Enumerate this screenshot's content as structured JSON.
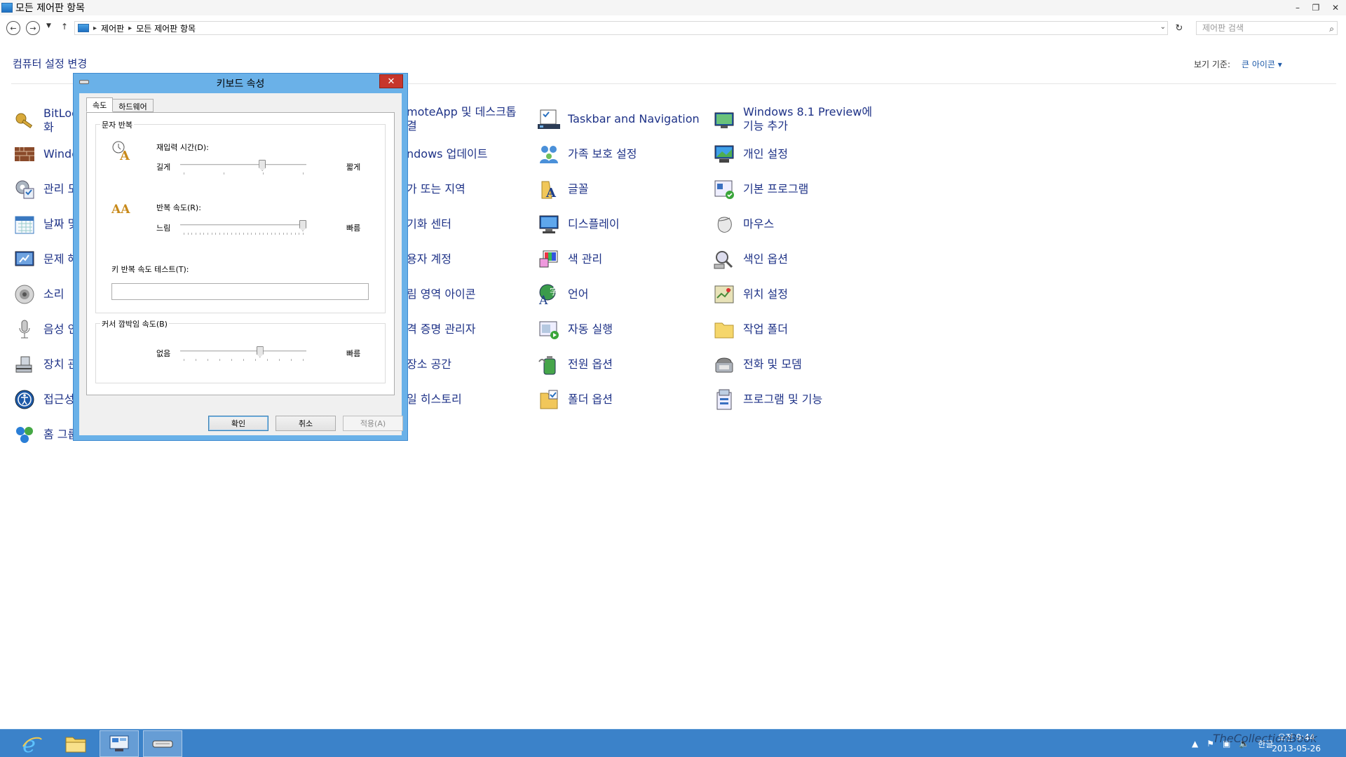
{
  "window": {
    "title": "모든 제어판 항목",
    "controls": [
      "–",
      "❐",
      "✕"
    ]
  },
  "address": {
    "breadcrumb": [
      "제어판",
      "모든 제어판 항목"
    ],
    "search_placeholder": "제어판 검색"
  },
  "header": {
    "title": "컴퓨터 설정 변경",
    "view_by_label": "보기 기준:",
    "view_by_value": "큰 아이콘 ▾"
  },
  "items": [
    {
      "label": "BitLoc",
      "label2": "화",
      "icon": "bitlocker-key-icon"
    },
    {
      "label": "Windc",
      "label2": "",
      "icon": "windows-firewall-icon"
    },
    {
      "label": "관리 도",
      "label2": "",
      "icon": "admin-tools-icon"
    },
    {
      "label": "날짜 및",
      "label2": "",
      "icon": "calendar-icon"
    },
    {
      "label": "문제 해",
      "label2": "",
      "icon": "troubleshoot-icon"
    },
    {
      "label": "소리",
      "label2": "",
      "icon": "speaker-icon"
    },
    {
      "label": "음성 인",
      "label2": "",
      "icon": "microphone-icon"
    },
    {
      "label": "장치 관",
      "label2": "",
      "icon": "device-manager-icon"
    },
    {
      "label": "접근성",
      "label2": "",
      "icon": "ease-of-access-icon"
    },
    {
      "label": "홈 그룹",
      "label2": "",
      "icon": "homegroup-icon"
    },
    {
      "label": "moteApp 및 데스크톱",
      "label2": "결",
      "icon": ""
    },
    {
      "label": "ndows 업데이트",
      "label2": "",
      "icon": ""
    },
    {
      "label": "가 또는 지역",
      "label2": "",
      "icon": ""
    },
    {
      "label": "기화 센터",
      "label2": "",
      "icon": ""
    },
    {
      "label": "용자 계정",
      "label2": "",
      "icon": ""
    },
    {
      "label": "림 영역 아이콘",
      "label2": "",
      "icon": ""
    },
    {
      "label": "격 증명 관리자",
      "label2": "",
      "icon": ""
    },
    {
      "label": "장소 공간",
      "label2": "",
      "icon": ""
    },
    {
      "label": "일 히스토리",
      "label2": "",
      "icon": ""
    },
    {
      "label": "Taskbar and Navigation",
      "label2": "",
      "icon": "taskbar-icon"
    },
    {
      "label": "가족 보호 설정",
      "label2": "",
      "icon": "family-safety-icon"
    },
    {
      "label": "글꼴",
      "label2": "",
      "icon": "fonts-folder-icon"
    },
    {
      "label": "디스플레이",
      "label2": "",
      "icon": "display-monitor-icon"
    },
    {
      "label": "색 관리",
      "label2": "",
      "icon": "color-management-icon"
    },
    {
      "label": "언어",
      "label2": "",
      "icon": "language-icon"
    },
    {
      "label": "자동 실행",
      "label2": "",
      "icon": "autoplay-icon"
    },
    {
      "label": "전원 옵션",
      "label2": "",
      "icon": "power-options-icon"
    },
    {
      "label": "폴더 옵션",
      "label2": "",
      "icon": "folder-options-icon"
    },
    {
      "label": "Windows 8.1 Preview에",
      "label2": "기능 추가",
      "icon": "add-features-icon"
    },
    {
      "label": "개인 설정",
      "label2": "",
      "icon": "personalization-icon"
    },
    {
      "label": "기본 프로그램",
      "label2": "",
      "icon": "default-programs-icon"
    },
    {
      "label": "마우스",
      "label2": "",
      "icon": "mouse-icon"
    },
    {
      "label": "색인 옵션",
      "label2": "",
      "icon": "indexing-icon"
    },
    {
      "label": "위치 설정",
      "label2": "",
      "icon": "location-icon"
    },
    {
      "label": "작업 폴더",
      "label2": "",
      "icon": "work-folder-icon"
    },
    {
      "label": "전화 및 모뎀",
      "label2": "",
      "icon": "phone-modem-icon"
    },
    {
      "label": "프로그램 및 기능",
      "label2": "",
      "icon": "programs-features-icon"
    }
  ],
  "dialog": {
    "title": "키보드 속성",
    "close": "✕",
    "tabs": [
      "속도",
      "하드웨어"
    ],
    "group1": "문자 반복",
    "delay_label": "재입력 시간(D):",
    "delay_left": "길게",
    "delay_right": "짧게",
    "delay_value": 0.66,
    "rate_label": "반복 속도(R):",
    "rate_left": "느림",
    "rate_right": "빠름",
    "rate_value": 1.0,
    "test_label": "키 반복 속도 테스트(T):",
    "group2": "커서 깜박임 속도(B)",
    "blink_left": "없음",
    "blink_right": "빠름",
    "blink_value": 0.64,
    "ok": "확인",
    "cancel": "취소",
    "apply": "적용(A)"
  },
  "taskbar": {
    "clock_time": "오전 9:44",
    "clock_date": "2013-05-26",
    "ime": "한글"
  },
  "watermark": "TheCollectionBook"
}
